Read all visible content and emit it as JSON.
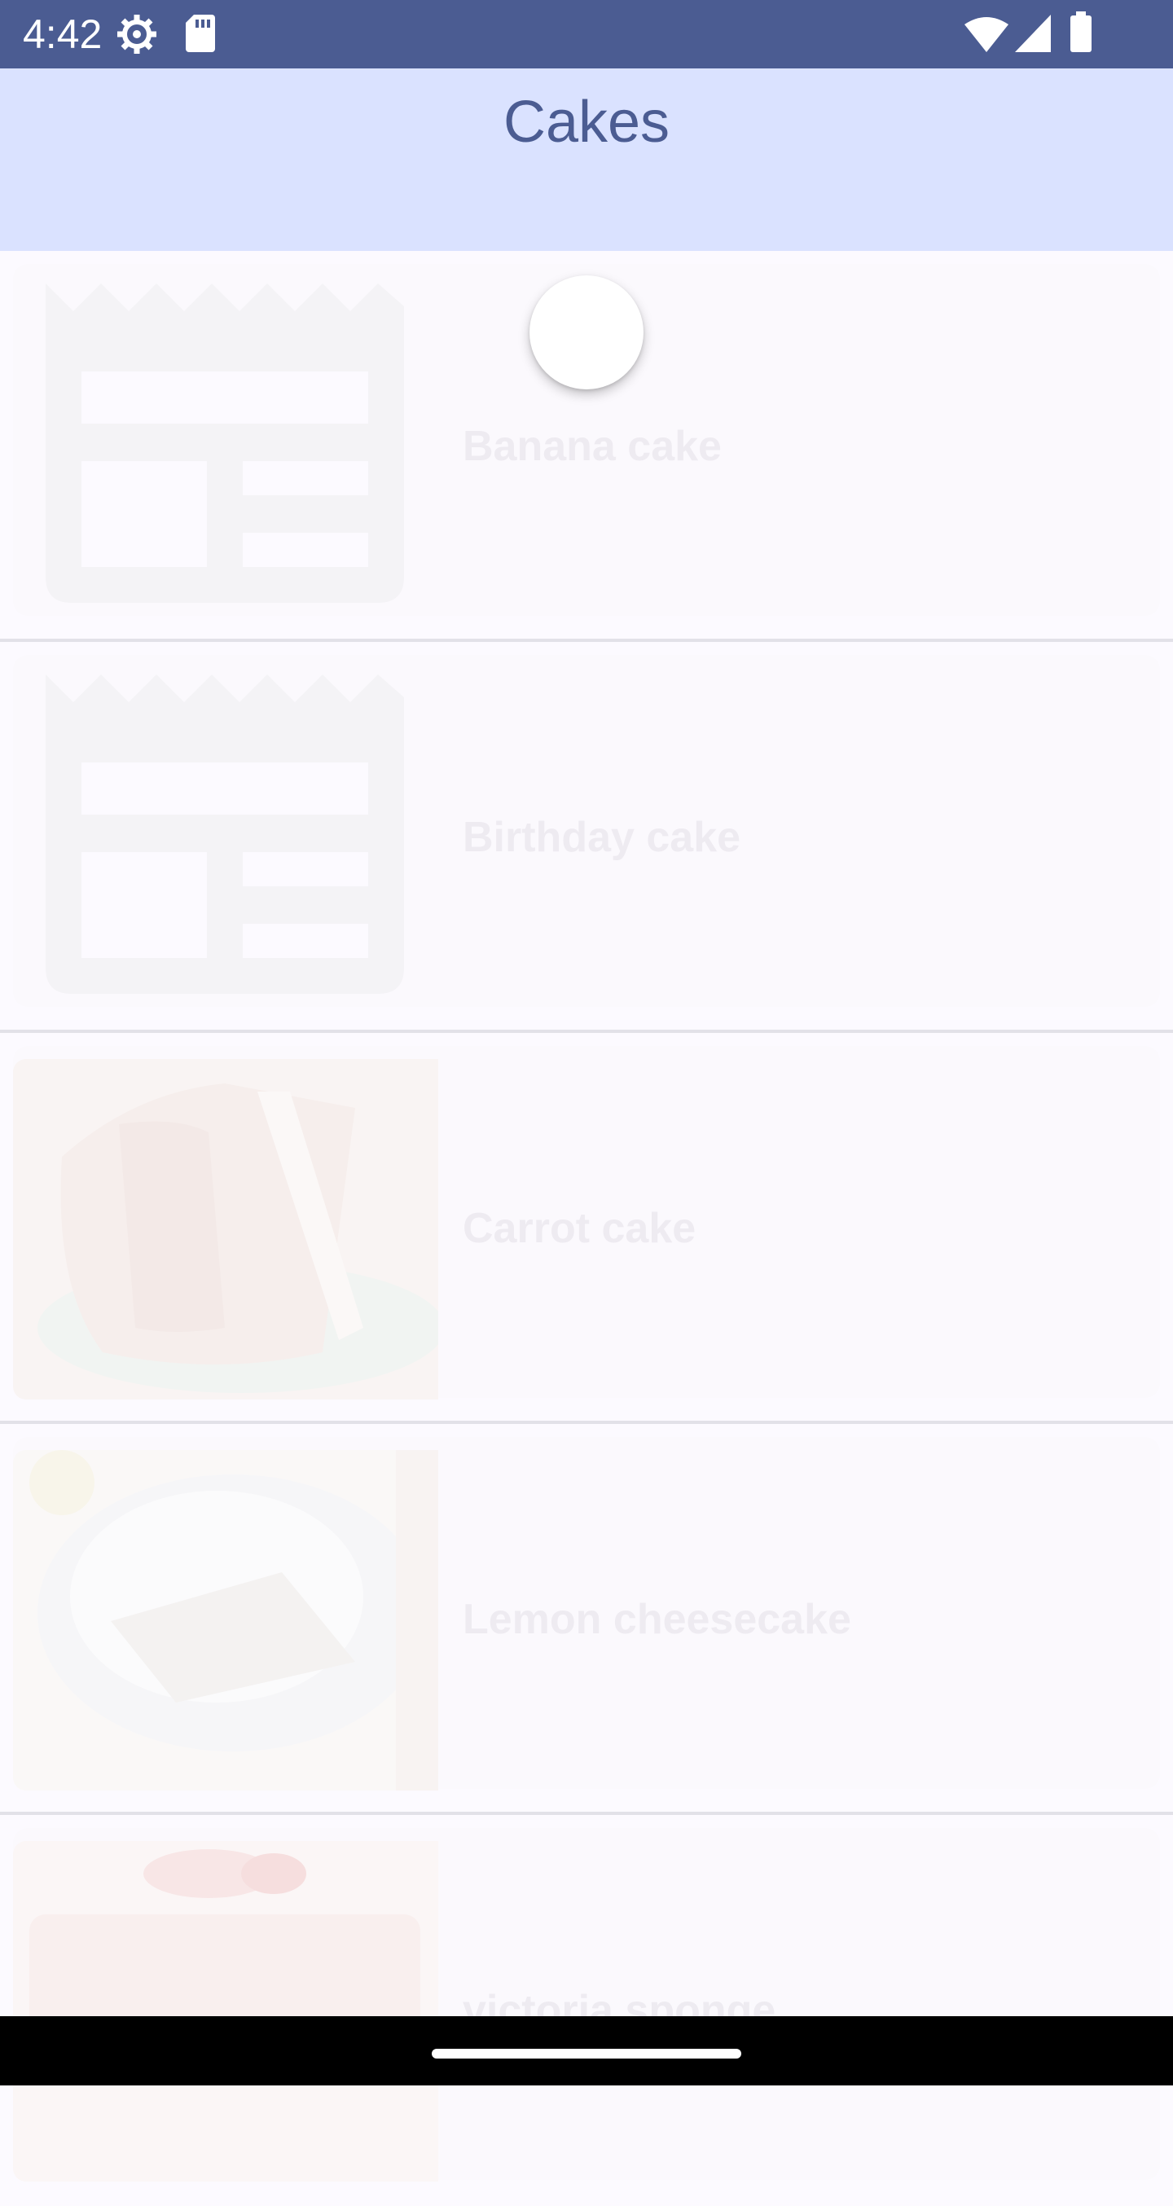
{
  "status_bar": {
    "time": "4:42",
    "left_icons": [
      "settings-icon",
      "sd-card-icon"
    ],
    "right_icons": [
      "wifi-icon",
      "cellular-signal-icon",
      "battery-icon"
    ]
  },
  "app_bar": {
    "title": "Cakes"
  },
  "cakes": [
    {
      "name": "Banana cake",
      "image": "placeholder"
    },
    {
      "name": "Birthday cake",
      "image": "placeholder"
    },
    {
      "name": "Carrot cake",
      "image": "photo"
    },
    {
      "name": "Lemon cheesecake",
      "image": "photo"
    },
    {
      "name": "victoria sponge",
      "image": "photo"
    }
  ],
  "loading": true,
  "colors": {
    "status_bar": "#4b5c92",
    "app_bar": "#dae2ff",
    "title": "#4b5c92",
    "background": "#fcfaff",
    "faded_text": "#eeebf1"
  }
}
